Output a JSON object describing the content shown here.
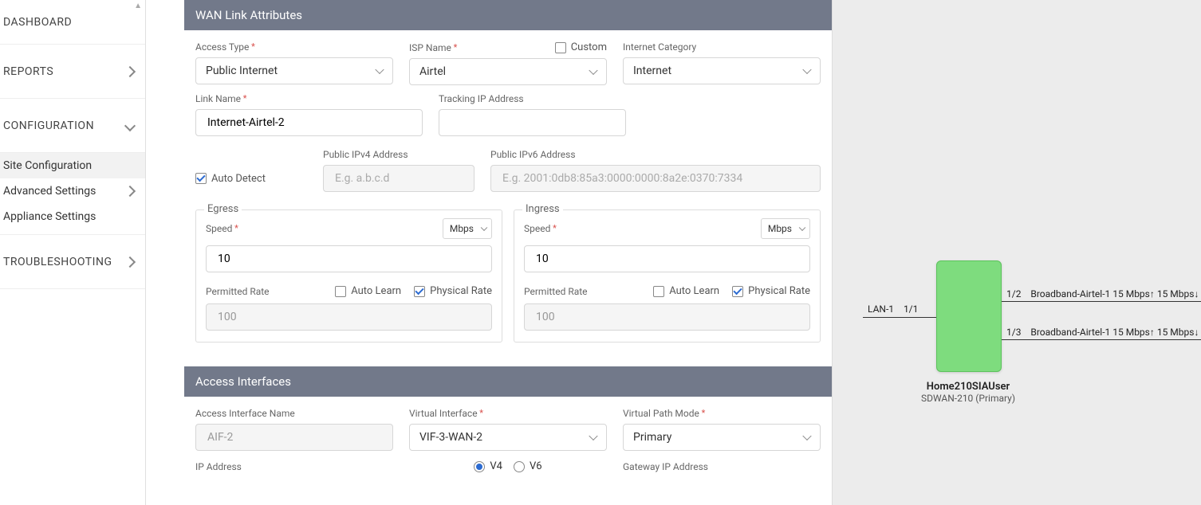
{
  "sidebar": {
    "dashboard": "DASHBOARD",
    "reports": "REPORTS",
    "configuration": "CONFIGURATION",
    "sub": {
      "site": "Site Configuration",
      "advanced": "Advanced Settings",
      "appliance": "Appliance Settings"
    },
    "troubleshooting": "TROUBLESHOOTING"
  },
  "wan": {
    "header": "WAN Link Attributes",
    "access_type_label": "Access Type",
    "access_type_value": "Public Internet",
    "isp_name_label": "ISP Name",
    "isp_name_value": "Airtel",
    "custom_label": "Custom",
    "internet_category_label": "Internet Category",
    "internet_category_value": "Internet",
    "link_name_label": "Link Name",
    "link_name_value": "Internet-Airtel-2",
    "tracking_ip_label": "Tracking IP Address",
    "tracking_ip_value": "",
    "auto_detect_label": "Auto Detect",
    "public_ipv4_label": "Public IPv4 Address",
    "public_ipv4_placeholder": "E.g. a.b.c.d",
    "public_ipv6_label": "Public IPv6 Address",
    "public_ipv6_placeholder": "E.g. 2001:0db8:85a3:0000:0000:8a2e:0370:7334"
  },
  "egress": {
    "legend": "Egress",
    "speed_label": "Speed",
    "speed_value": "10",
    "speed_unit": "Mbps",
    "permitted_rate_label": "Permitted Rate",
    "permitted_rate_value": "100",
    "auto_learn_label": "Auto Learn",
    "physical_rate_label": "Physical Rate"
  },
  "ingress": {
    "legend": "Ingress",
    "speed_label": "Speed",
    "speed_value": "10",
    "speed_unit": "Mbps",
    "permitted_rate_label": "Permitted Rate",
    "permitted_rate_value": "100",
    "auto_learn_label": "Auto Learn",
    "physical_rate_label": "Physical Rate"
  },
  "access_if": {
    "header": "Access Interfaces",
    "name_label": "Access Interface Name",
    "name_value": "AIF-2",
    "virtual_if_label": "Virtual Interface",
    "virtual_if_value": "VIF-3-WAN-2",
    "vpm_label": "Virtual Path Mode",
    "vpm_value": "Primary",
    "ip_address_label": "IP Address",
    "v4_label": "V4",
    "v6_label": "V6",
    "gateway_label": "Gateway IP Address"
  },
  "diagram": {
    "device_name": "Home210SIAUser",
    "device_model": "SDWAN-210 (Primary)",
    "lan_label": "LAN-1",
    "lan_port": "1/1",
    "wan1_port": "1/2",
    "wan1_label": "Broadband-Airtel-1 15 Mbps↑ 15 Mbps↓",
    "wan2_port": "1/3",
    "wan2_label": "Broadband-Airtel-1 15 Mbps↑ 15 Mbps↓"
  }
}
